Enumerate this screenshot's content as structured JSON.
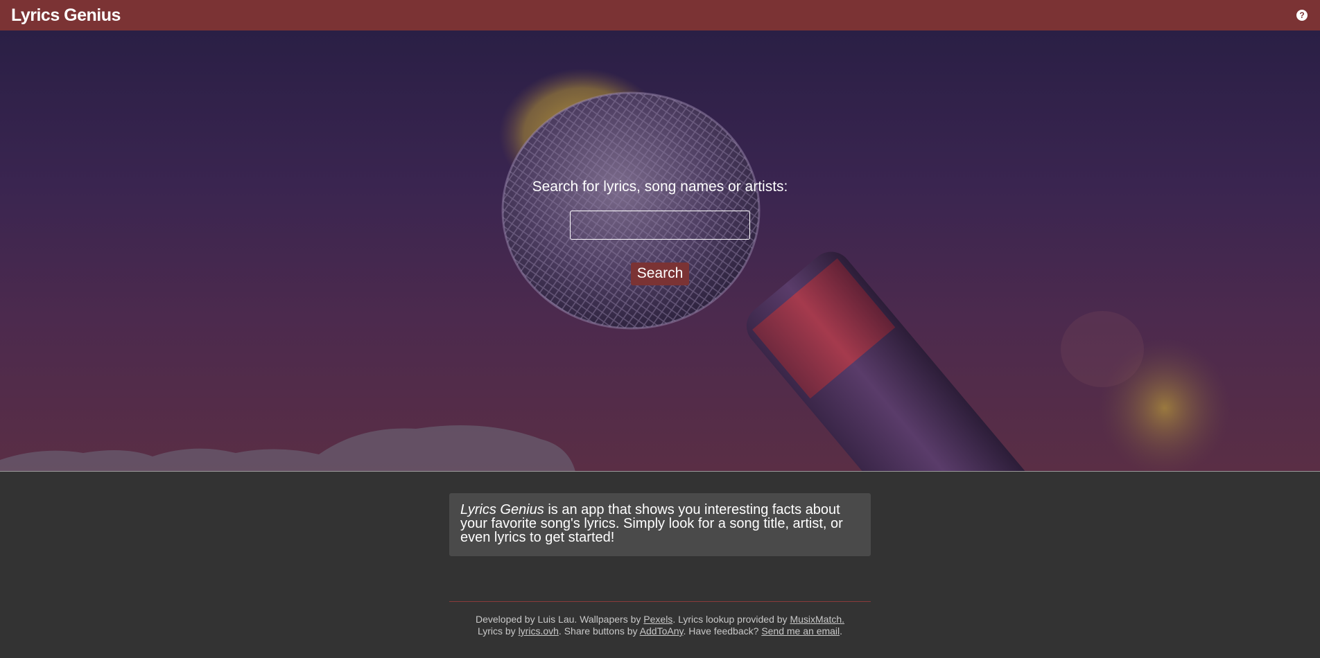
{
  "header": {
    "brand": "Lyrics Genius",
    "help_icon": "question-circle-icon"
  },
  "search": {
    "label": "Search for lyrics, song names or artists:",
    "input_value": "",
    "placeholder": "",
    "button_label": "Search"
  },
  "about": {
    "app_name": "Lyrics Genius",
    "text": " is an app that shows you interesting facts about your favorite song's lyrics. Simply look for a song title, artist, or even lyrics to get started!"
  },
  "footer": {
    "t1": "Developed by Luis Lau. Wallpapers by ",
    "link_pexels": "Pexels",
    "t2": ". Lyrics lookup provided by ",
    "link_musixmatch": "MusixMatch.",
    "t3": "Lyrics by ",
    "link_lyricsovh": "lyrics.ovh",
    "t4": ". Share buttons by ",
    "link_addtoany": "AddToAny",
    "t5": ". Have feedback? ",
    "link_email": "Send me an email",
    "t6": "."
  },
  "colors": {
    "accent": "#7b3334",
    "page_bg": "#333333",
    "card_bg": "#4a4a4a"
  }
}
